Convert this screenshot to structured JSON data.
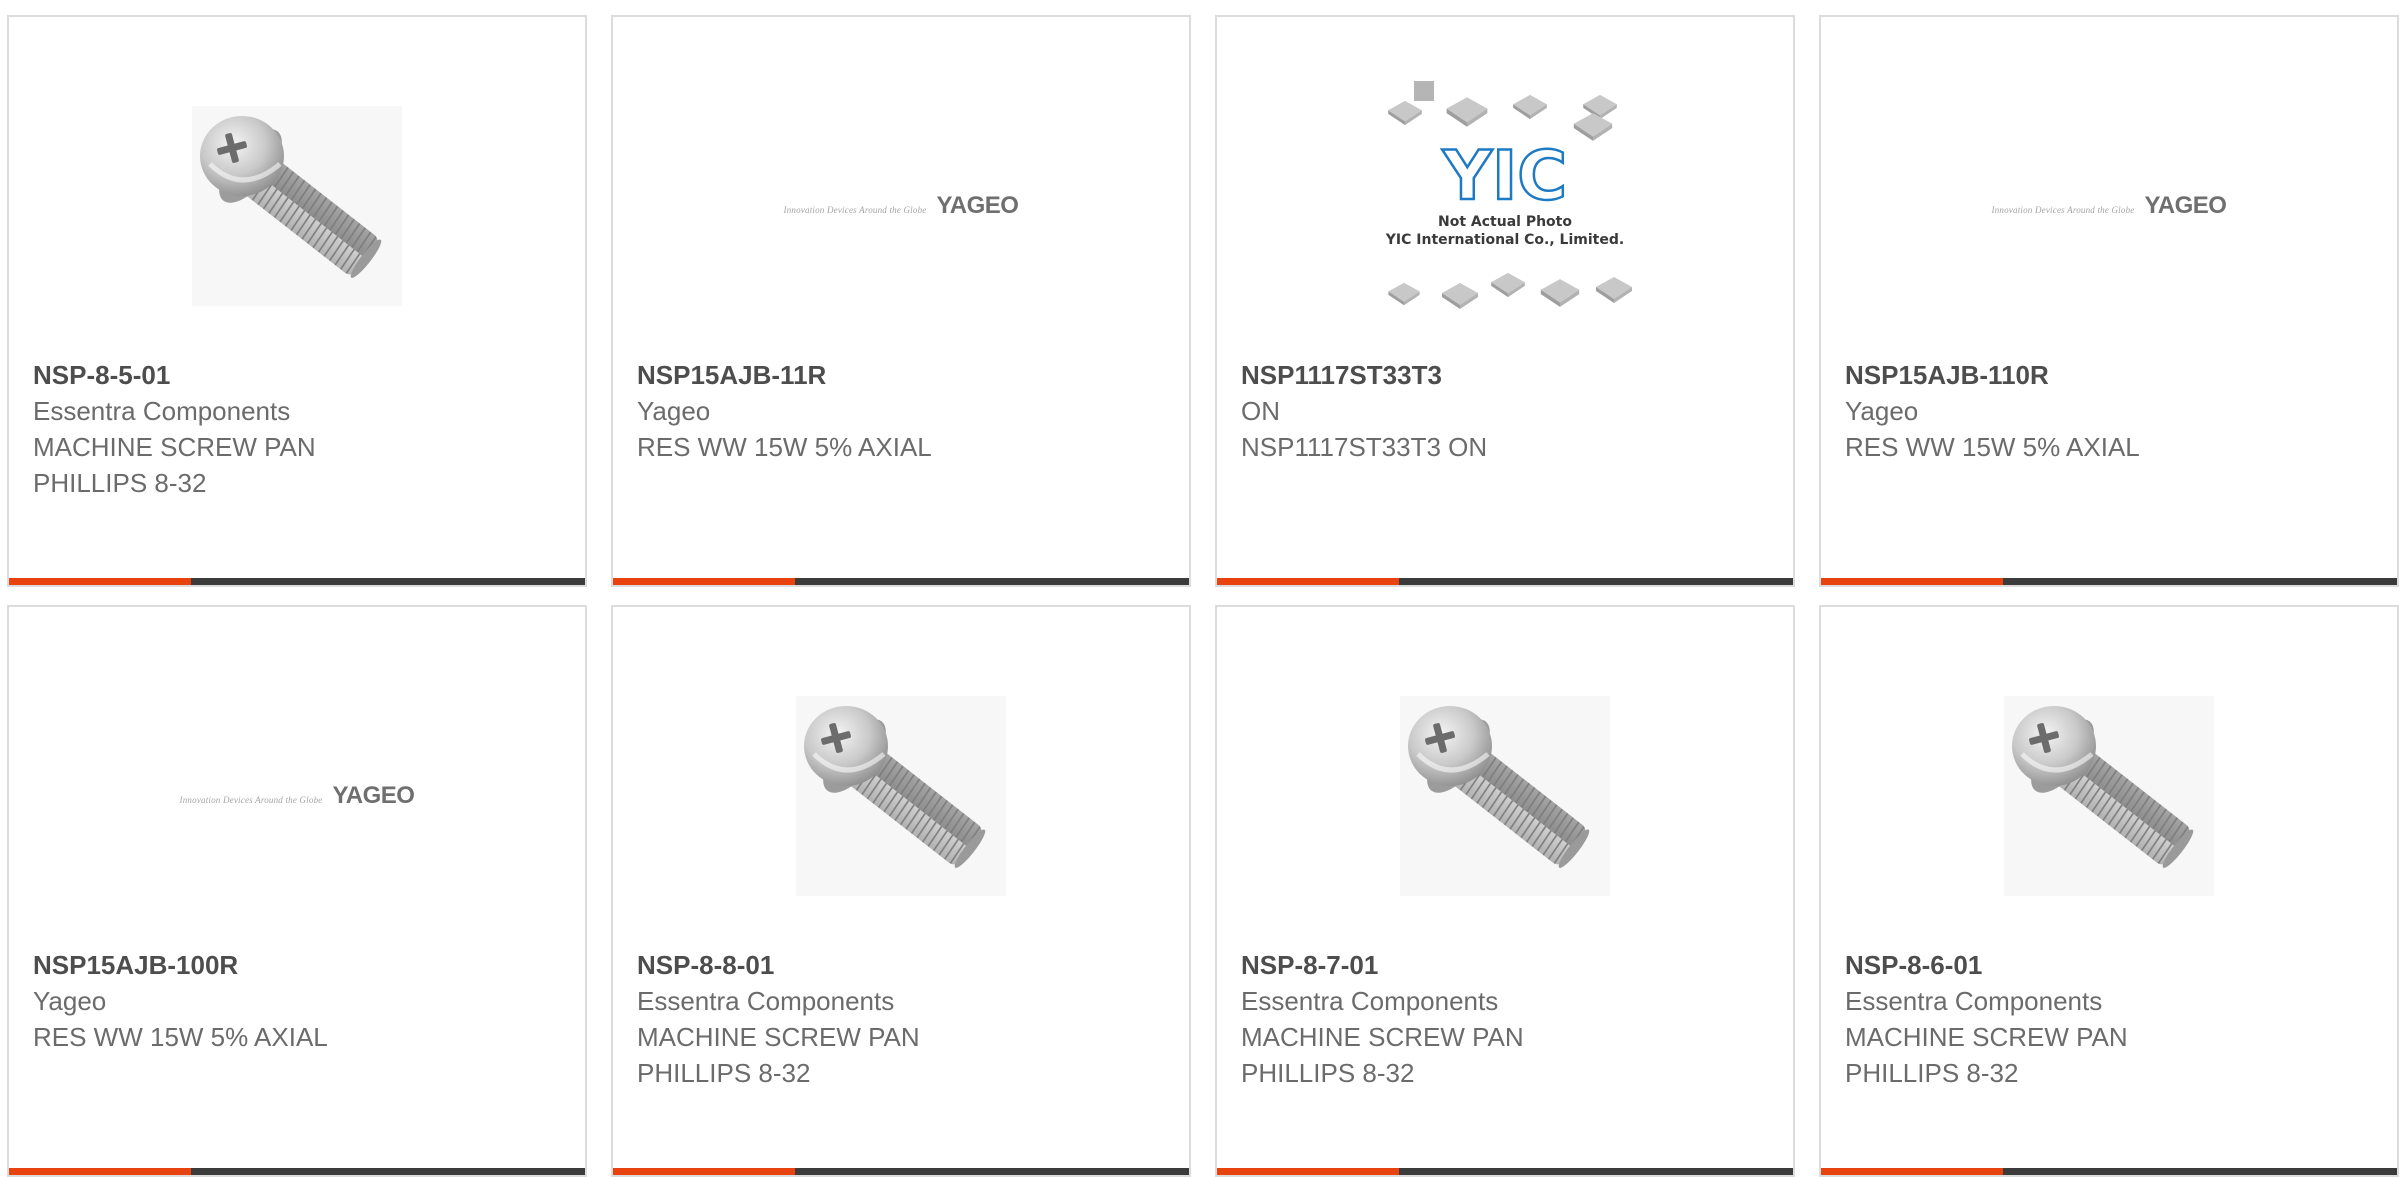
{
  "accent_color": "#e8420f",
  "bar_color": "#3b3b3b",
  "products": [
    {
      "part_number": "NSP-8-5-01",
      "manufacturer": "Essentra Components",
      "description": "MACHINE SCREW PAN\nPHILLIPS 8-32",
      "image": "screw-image"
    },
    {
      "part_number": "NSP15AJB-11R",
      "manufacturer": "Yageo",
      "description": "RES WW 15W 5% AXIAL",
      "image": "yageo-logo",
      "logo": {
        "tagline": "Innovation Devices Around the Globe",
        "brand": "YAGEO"
      }
    },
    {
      "part_number": "NSP1117ST33T3",
      "manufacturer": "ON",
      "description": "NSP1117ST33T3 ON",
      "image": "yic-placeholder",
      "placeholder": {
        "logo": "YIC",
        "line1": "Not Actual Photo",
        "line2": "YIC International Co., Limited."
      }
    },
    {
      "part_number": "NSP15AJB-110R",
      "manufacturer": "Yageo",
      "description": "RES WW 15W 5% AXIAL",
      "image": "yageo-logo",
      "logo": {
        "tagline": "Innovation Devices Around the Globe",
        "brand": "YAGEO"
      }
    },
    {
      "part_number": "NSP15AJB-100R",
      "manufacturer": "Yageo",
      "description": "RES WW 15W 5% AXIAL",
      "image": "yageo-logo",
      "logo": {
        "tagline": "Innovation Devices Around the Globe",
        "brand": "YAGEO"
      }
    },
    {
      "part_number": "NSP-8-8-01",
      "manufacturer": "Essentra Components",
      "description": "MACHINE SCREW PAN\nPHILLIPS 8-32",
      "image": "screw-image"
    },
    {
      "part_number": "NSP-8-7-01",
      "manufacturer": "Essentra Components",
      "description": "MACHINE SCREW PAN\nPHILLIPS 8-32",
      "image": "screw-image"
    },
    {
      "part_number": "NSP-8-6-01",
      "manufacturer": "Essentra Components",
      "description": "MACHINE SCREW PAN\nPHILLIPS 8-32",
      "image": "screw-image"
    }
  ]
}
